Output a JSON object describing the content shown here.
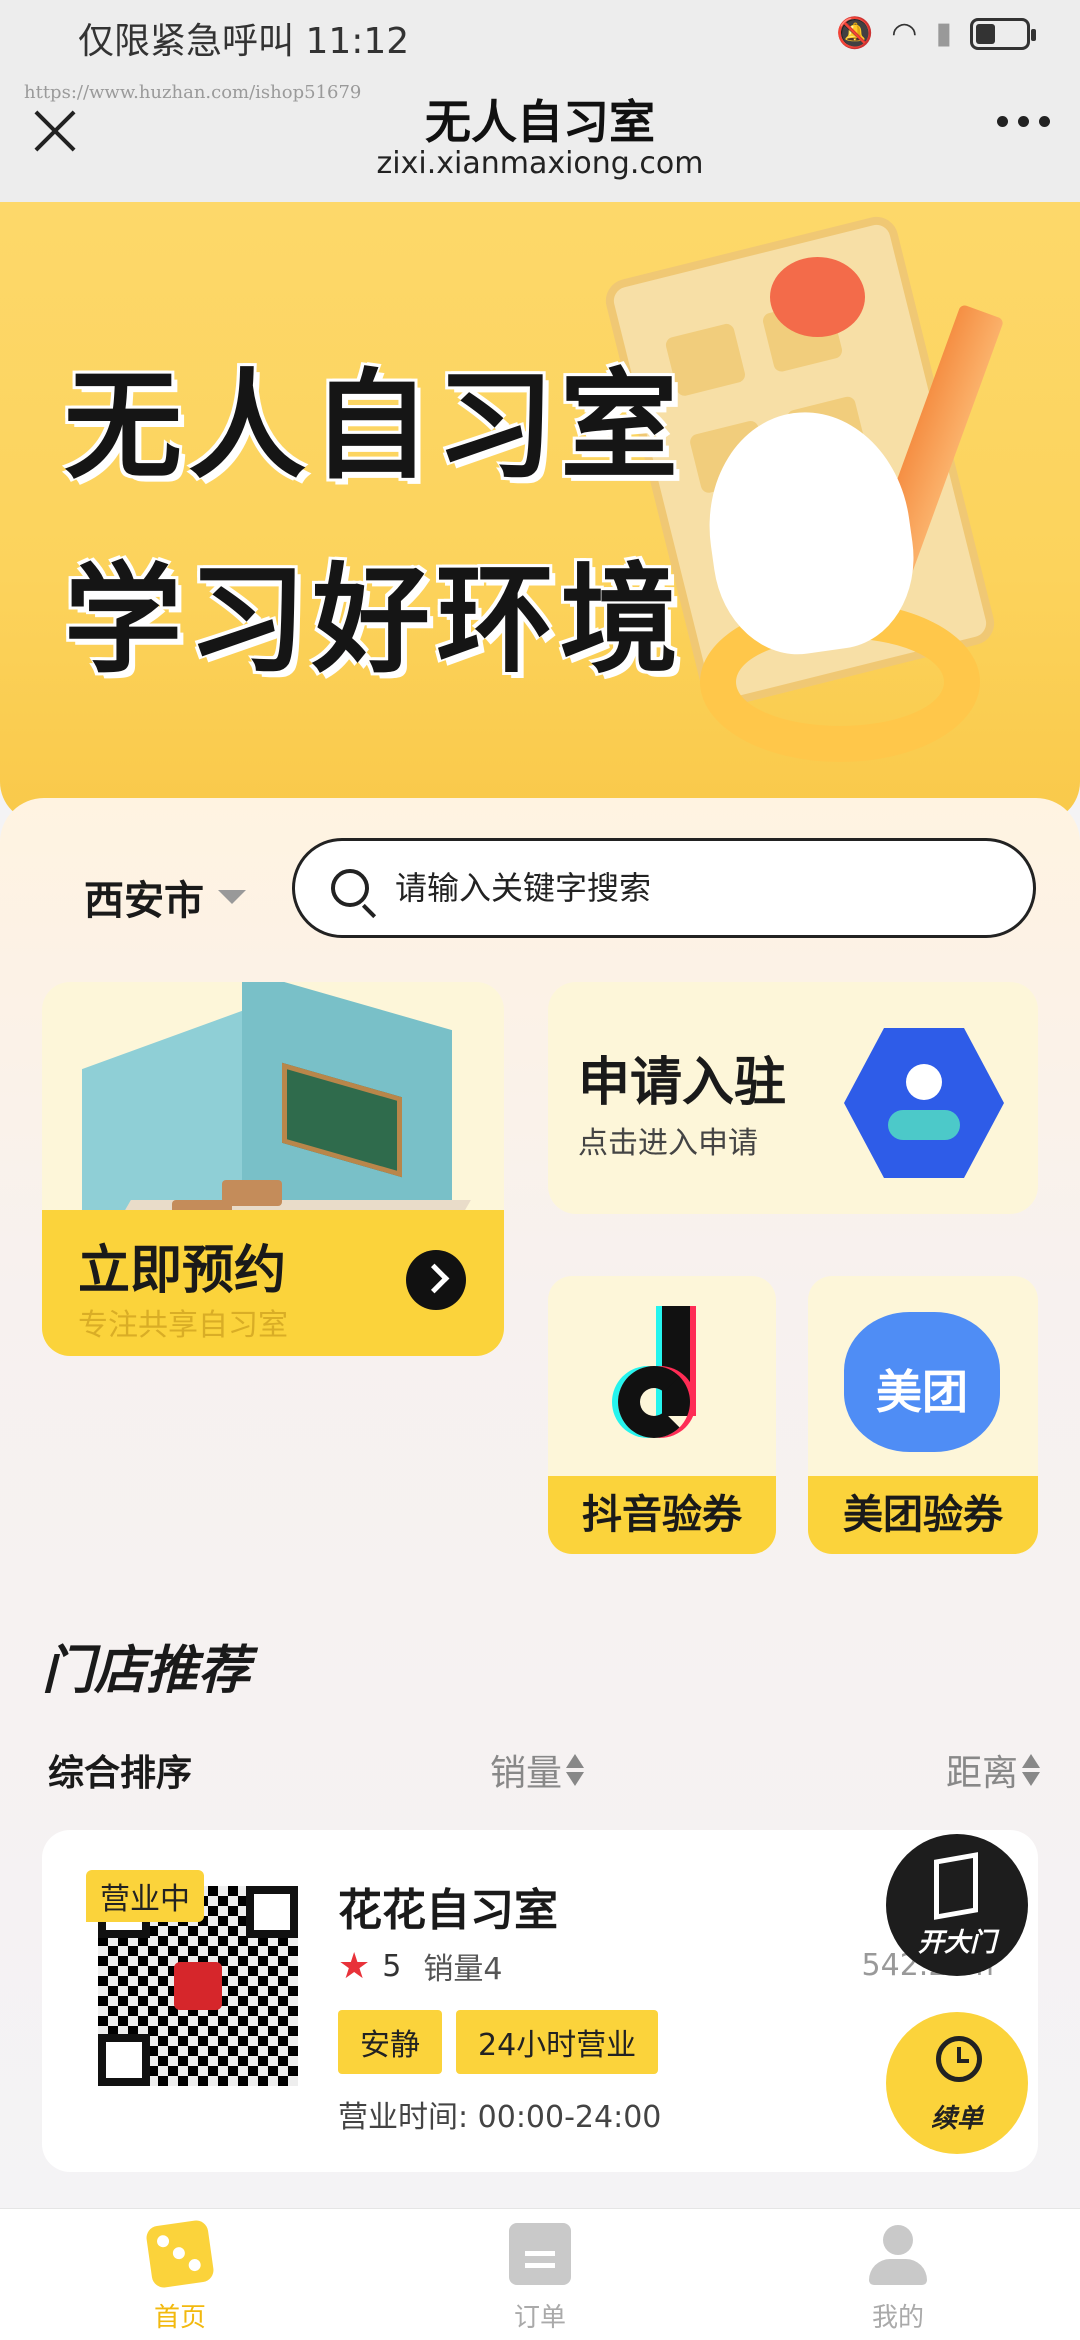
{
  "status_bar": {
    "carrier_time": "仅限紧急呼叫 11:12",
    "battery_level": 0.35
  },
  "title_bar": {
    "watermark": "https://www.huzhan.com/ishop51679",
    "title": "无人自习室",
    "domain": "zixi.xianmaxiong.com"
  },
  "banner": {
    "line1": "无人自习室",
    "line2": "学习好环境"
  },
  "search": {
    "city": "西安市",
    "placeholder": "请输入关键字搜索"
  },
  "cards": {
    "book": {
      "title": "立即预约",
      "subtitle": "专注共享自习室"
    },
    "apply": {
      "title": "申请入驻",
      "subtitle": "点击进入申请"
    },
    "douyin": {
      "label": "抖音验券"
    },
    "meituan": {
      "label": "美团验券",
      "badge_text": "美团"
    }
  },
  "section": {
    "title": "门店推荐",
    "sort": {
      "default": "综合排序",
      "sales": "销量",
      "distance": "距离"
    }
  },
  "store": {
    "status": "营业中",
    "name": "花花自习室",
    "rating": "5",
    "sales": "销量4",
    "distance": "542.2km",
    "tags": [
      "安静",
      "24小时营业"
    ],
    "hours": "营业时间:  00:00-24:00"
  },
  "floating": {
    "open_door": "开大门",
    "renew": "续单"
  },
  "bottom_nav": [
    {
      "label": "首页",
      "icon": "dice-home-icon",
      "active": true
    },
    {
      "label": "订单",
      "icon": "document-icon",
      "active": false
    },
    {
      "label": "我的",
      "icon": "user-icon",
      "active": false
    }
  ],
  "colors": {
    "accent": "#fbd33b",
    "active_nav": "#f2b90f",
    "star": "#e8323a"
  }
}
